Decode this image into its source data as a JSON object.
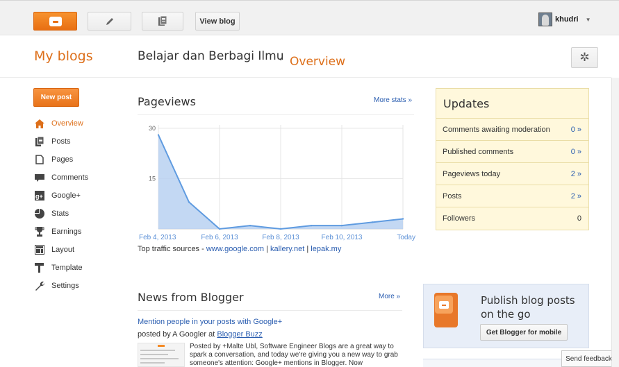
{
  "toolbar": {
    "view_blog_label": "View blog",
    "username": "khudri"
  },
  "header": {
    "my_blogs": "My blogs",
    "blog_title": "Belajar dan Berbagi Ilmu",
    "separator": ".",
    "section": "Overview"
  },
  "sidebar": {
    "new_post_label": "New post",
    "items": [
      {
        "label": "Overview",
        "icon": "home-icon",
        "active": true
      },
      {
        "label": "Posts",
        "icon": "posts-icon"
      },
      {
        "label": "Pages",
        "icon": "pages-icon"
      },
      {
        "label": "Comments",
        "icon": "comments-icon"
      },
      {
        "label": "Google+",
        "icon": "google-plus-icon"
      },
      {
        "label": "Stats",
        "icon": "stats-icon"
      },
      {
        "label": "Earnings",
        "icon": "trophy-icon"
      },
      {
        "label": "Layout",
        "icon": "layout-icon"
      },
      {
        "label": "Template",
        "icon": "template-icon"
      },
      {
        "label": "Settings",
        "icon": "wrench-icon"
      }
    ]
  },
  "pageviews": {
    "title": "Pageviews",
    "more_stats": "More stats »",
    "traffic_prefix": "Top traffic sources - ",
    "sources": [
      "www.google.com",
      "kallery.net",
      "lepak.my"
    ],
    "source_sep": " | "
  },
  "chart_data": {
    "type": "area",
    "x": [
      "Feb 4, 2013",
      "Feb 5, 2013",
      "Feb 6, 2013",
      "Feb 7, 2013",
      "Feb 8, 2013",
      "Feb 9, 2013",
      "Feb 10, 2013",
      "Feb 11, 2013",
      "Today"
    ],
    "values": [
      28,
      8,
      0,
      1,
      0,
      1,
      1,
      2,
      3
    ],
    "x_tick_labels": [
      "Feb 4, 2013",
      "Feb 6, 2013",
      "Feb 8, 2013",
      "Feb 10, 2013",
      "Today"
    ],
    "y_ticks": [
      15,
      30
    ],
    "ylim": [
      0,
      31
    ],
    "grid": true,
    "color": "#5f9be0",
    "fill": "#b9d1f1"
  },
  "updates": {
    "title": "Updates",
    "rows": [
      {
        "label": "Comments awaiting moderation",
        "value": "0 »"
      },
      {
        "label": "Published comments",
        "value": "0 »"
      },
      {
        "label": "Pageviews today",
        "value": "2 »"
      },
      {
        "label": "Posts",
        "value": "2 »"
      },
      {
        "label": "Followers",
        "value": "0"
      }
    ]
  },
  "news": {
    "title": "News from Blogger",
    "more": "More »",
    "headline": "Mention people in your posts with Google+",
    "by_prefix": "posted by A Googler at ",
    "by_link": "Blogger Buzz",
    "excerpt": "Posted by +Malte Ubl, Software Engineer Blogs are a great way to spark a conversation, and today we're giving you a new way to grab someone's attention: Google+ mentions in Blogger. Now"
  },
  "mobile": {
    "text": "Publish blog posts on the go",
    "button": "Get Blogger for mobile"
  },
  "feedback": "Send feedback"
}
